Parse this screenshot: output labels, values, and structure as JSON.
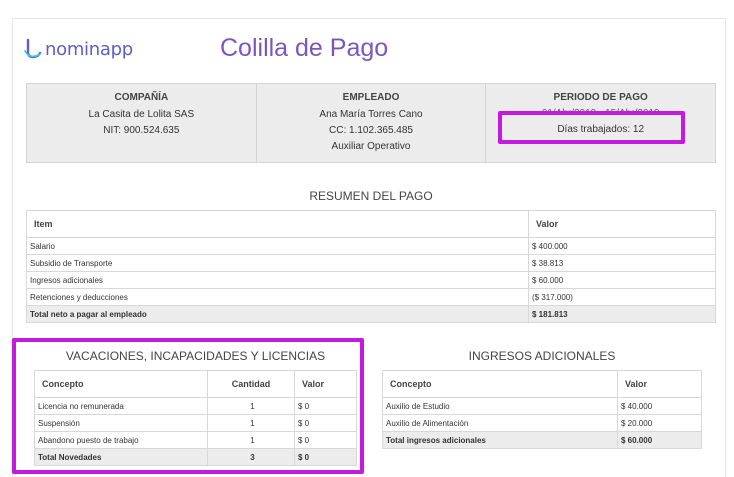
{
  "brand": {
    "logo_text": "nominapp",
    "accent": "#7b56c0",
    "logo_color": "#5b5fc7",
    "highlight_color": "#c41ae0"
  },
  "document": {
    "title": "Colilla de Pago"
  },
  "company": {
    "heading": "COMPAÑÍA",
    "name": "La Casita de Lolita SAS",
    "nit": "NIT: 900.524.635"
  },
  "employee": {
    "heading": "EMPLEADO",
    "name": "Ana María Torres Cano",
    "cc": "CC: 1.102.365.485",
    "role": "Auxiliar Operativo"
  },
  "period": {
    "heading": "PERIODO DE PAGO",
    "range": "01/Abr/2019 - 15/Abr/2019",
    "days": "Días trabajados: 12"
  },
  "summary": {
    "title": "RESUMEN DEL PAGO",
    "headers": [
      "Item",
      "Valor"
    ],
    "rows": [
      [
        "Salario",
        "$ 400.000"
      ],
      [
        "Subsidio de Transporte",
        "$ 38.813"
      ],
      [
        "Ingresos adicionales",
        "$ 60.000"
      ],
      [
        "Retenciones y deducciones",
        "($ 317.000)"
      ]
    ],
    "total": [
      "Total neto a pagar al empleado",
      "$ 181.813"
    ]
  },
  "novelties": {
    "title": "VACACIONES, INCAPACIDADES Y LICENCIAS",
    "headers": [
      "Concepto",
      "Cantidad",
      "Valor"
    ],
    "rows": [
      [
        "Licencia no remunerada",
        "1",
        "$ 0"
      ],
      [
        "Suspensión",
        "1",
        "$ 0"
      ],
      [
        "Abandono puesto de trabajo",
        "1",
        "$ 0"
      ]
    ],
    "total": [
      "Total Novedades",
      "3",
      "$ 0"
    ]
  },
  "income": {
    "title": "INGRESOS ADICIONALES",
    "headers": [
      "Concepto",
      "Valor"
    ],
    "rows": [
      [
        "Auxilio de Estudio",
        "$ 40.000"
      ],
      [
        "Auxilio de Alimentación",
        "$ 20.000"
      ]
    ],
    "total": [
      "Total ingresos adicionales",
      "$ 60.000"
    ]
  }
}
